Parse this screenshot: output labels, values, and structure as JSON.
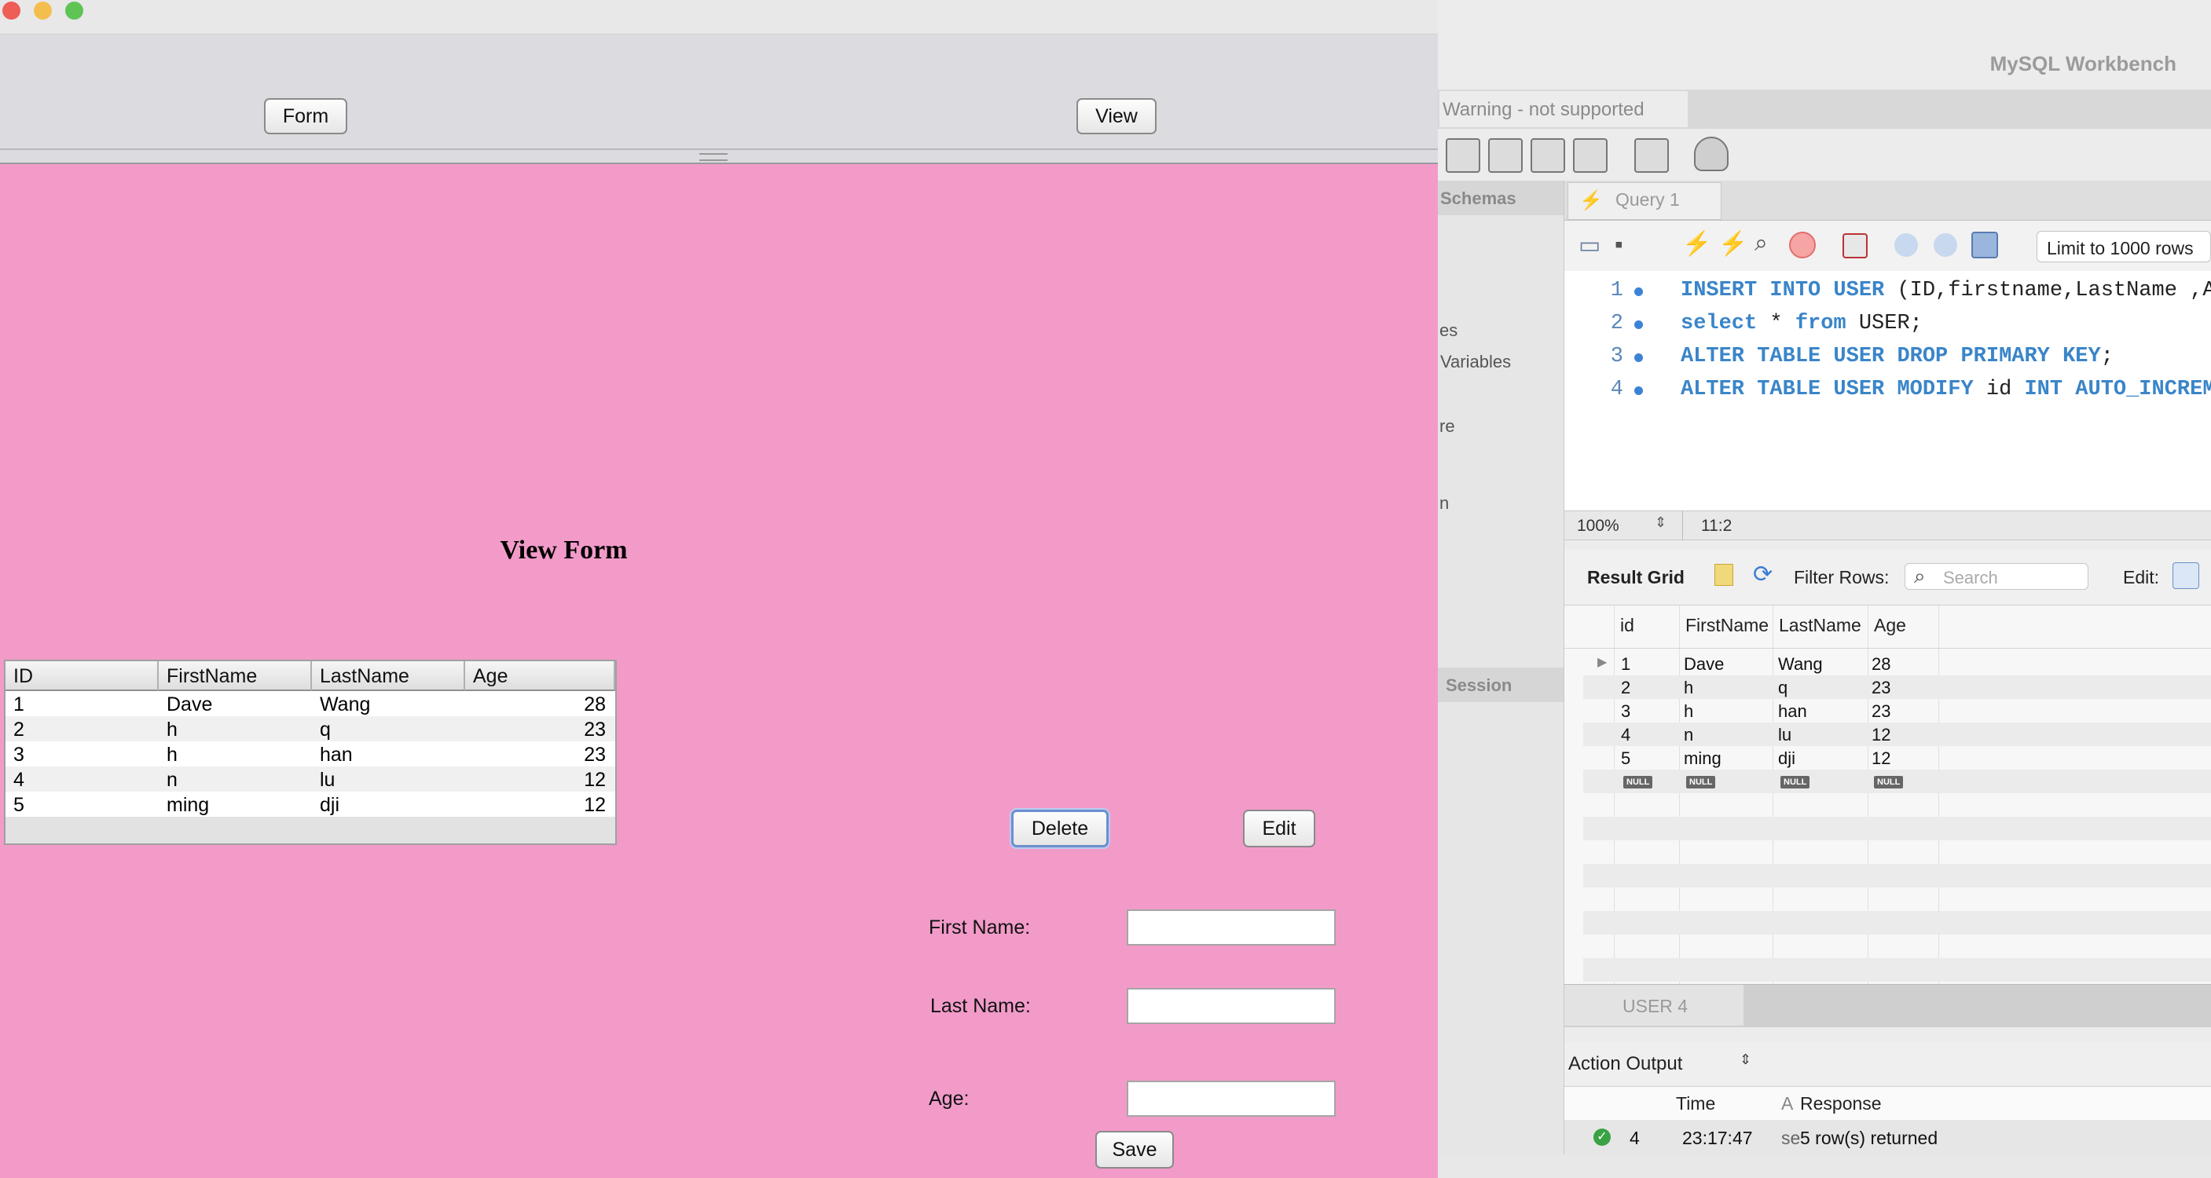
{
  "java_app": {
    "toolbar": {
      "form_button": "Form",
      "view_button": "View"
    },
    "title": "View Form",
    "table": {
      "columns": [
        "ID",
        "FirstName",
        "LastName",
        "Age"
      ],
      "rows": [
        {
          "id": "1",
          "first": "Dave",
          "last": "Wang",
          "age": "28"
        },
        {
          "id": "2",
          "first": "h",
          "last": "q",
          "age": "23"
        },
        {
          "id": "3",
          "first": "h",
          "last": "han",
          "age": "23"
        },
        {
          "id": "4",
          "first": "n",
          "last": "lu",
          "age": "12"
        },
        {
          "id": "5",
          "first": "ming",
          "last": "dji",
          "age": "12"
        }
      ]
    },
    "delete_button": "Delete",
    "edit_button": "Edit",
    "form": {
      "first_name_label": "First Name:",
      "last_name_label": "Last Name:",
      "age_label": "Age:",
      "first_name_value": "",
      "last_name_value": "",
      "age_value": "",
      "save_button": "Save"
    }
  },
  "workbench": {
    "app_title": "MySQL Workbench",
    "warning_tab": "Warning - not supported",
    "sidebar": {
      "schemas_header": "Schemas",
      "fragments": [
        "es",
        "Variables",
        "re",
        "n"
      ],
      "session_header": "Session"
    },
    "query_tab": "Query 1",
    "limit_select": "Limit to 1000 rows",
    "sql_lines": [
      {
        "no": "1",
        "kw1": "INSERT INTO USER",
        "rest": " (ID,firstname,LastName ,Ag"
      },
      {
        "no": "2",
        "kw1": "select",
        "rest": " * ",
        "kw2": "from",
        "rest2": " USER;"
      },
      {
        "no": "3",
        "kw1": "ALTER TABLE USER DROP PRIMARY KEY",
        "rest": ";"
      },
      {
        "no": "4",
        "kw1": "ALTER TABLE USER MODIFY",
        "rest": " id ",
        "kw2": "INT AUTO_INCREME"
      }
    ],
    "status": {
      "zoom": "100%",
      "cursor": "11:2"
    },
    "result_toolbar": {
      "result_grid": "Result Grid",
      "filter_rows": "Filter Rows:",
      "search_placeholder": "Search",
      "edit": "Edit:"
    },
    "grid": {
      "columns": [
        "id",
        "FirstName",
        "LastName",
        "Age"
      ],
      "rows": [
        {
          "id": "1",
          "first": "Dave",
          "last": "Wang",
          "age": "28"
        },
        {
          "id": "2",
          "first": "h",
          "last": "q",
          "age": "23"
        },
        {
          "id": "3",
          "first": "h",
          "last": "han",
          "age": "23"
        },
        {
          "id": "4",
          "first": "n",
          "last": "lu",
          "age": "12"
        },
        {
          "id": "5",
          "first": "ming",
          "last": "dji",
          "age": "12"
        }
      ],
      "null_label": "NULL"
    },
    "result_tab": "USER 4",
    "action_output": "Action Output",
    "output_columns": {
      "time": "Time",
      "action": "A",
      "response": "Response"
    },
    "output_row": {
      "num": "4",
      "time": "23:17:47",
      "action": "se",
      "response": "5 row(s) returned"
    }
  },
  "colors": {
    "pink_bg": "#f29bc9",
    "keyword_blue": "#3a85c9"
  }
}
